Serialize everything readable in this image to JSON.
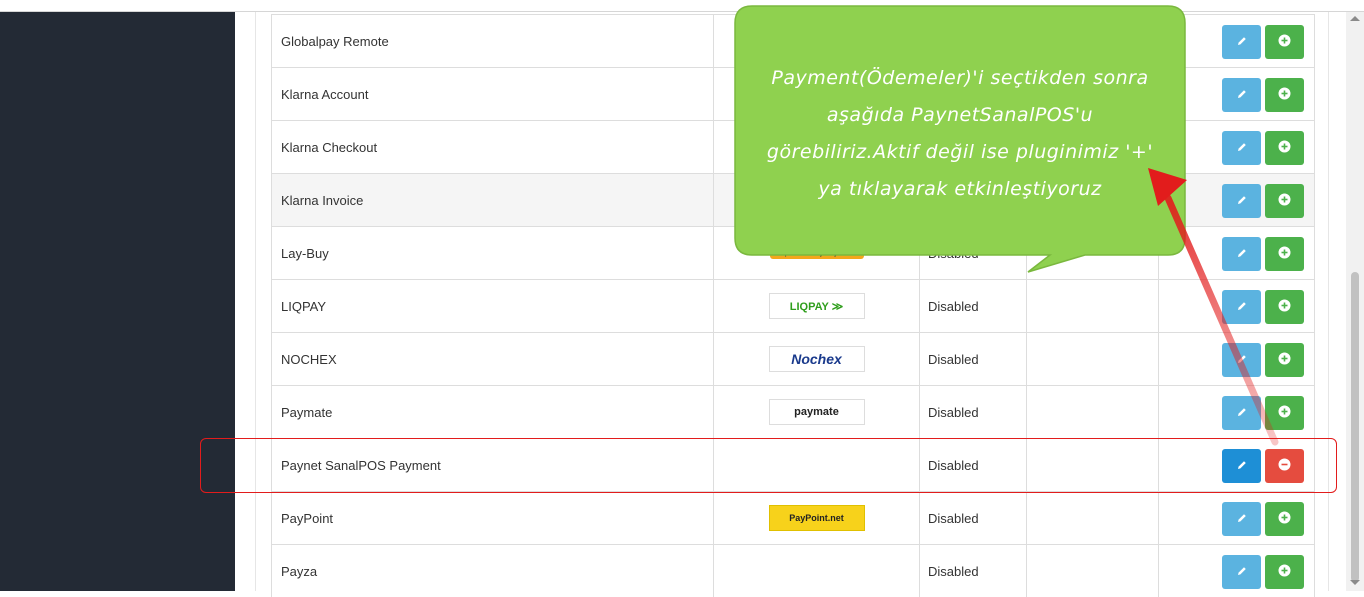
{
  "rows": [
    {
      "name": "Globalpay Remote",
      "logo": "",
      "logo_kind": "",
      "status": "",
      "action": "add"
    },
    {
      "name": "Klarna Account",
      "logo": "",
      "logo_kind": "",
      "status": "",
      "action": "add"
    },
    {
      "name": "Klarna Checkout",
      "logo": "",
      "logo_kind": "",
      "status": "",
      "action": "add"
    },
    {
      "name": "Klarna Invoice",
      "logo": "",
      "logo_kind": "",
      "status": "",
      "action": "add",
      "highlight": true
    },
    {
      "name": "Lay-Buy",
      "logo": "powered by PayPal",
      "logo_kind": "paypal",
      "status": "Disabled",
      "action": "add"
    },
    {
      "name": "LIQPAY",
      "logo": "LIQPAY ≫",
      "logo_kind": "liqpay",
      "status": "Disabled",
      "action": "add"
    },
    {
      "name": "NOCHEX",
      "logo": "Nochex",
      "logo_kind": "nochex",
      "status": "Disabled",
      "action": "add"
    },
    {
      "name": "Paymate",
      "logo": "paymate",
      "logo_kind": "paymate",
      "status": "Disabled",
      "action": "add"
    },
    {
      "name": "Paynet SanalPOS Payment",
      "logo": "",
      "logo_kind": "",
      "status": "Disabled",
      "action": "remove",
      "edit_active": true
    },
    {
      "name": "PayPoint",
      "logo": "PayPoint.net",
      "logo_kind": "paypoint",
      "status": "Disabled",
      "action": "add"
    },
    {
      "name": "Payza",
      "logo": "",
      "logo_kind": "",
      "status": "Disabled",
      "action": "add"
    }
  ],
  "callout": {
    "lines": [
      "Payment(Ödemeler)'i seçtikden sonra",
      "aşağıda PaynetSanalPOS'u",
      "görebiliriz.Aktif değil ise pluginimiz '+'",
      "ya tıklayarak etkinleştiyoruz"
    ]
  },
  "colors": {
    "sidebar": "#232a35",
    "edit_button": "#5bb3e0",
    "add_button": "#4cb14b",
    "remove_button": "#e54c3f",
    "callout_green": "#8fd14f",
    "annotation_red": "#e21c1c"
  },
  "icons": {
    "edit": "pencil-icon",
    "add": "plus-circle-icon",
    "remove": "minus-circle-icon"
  }
}
